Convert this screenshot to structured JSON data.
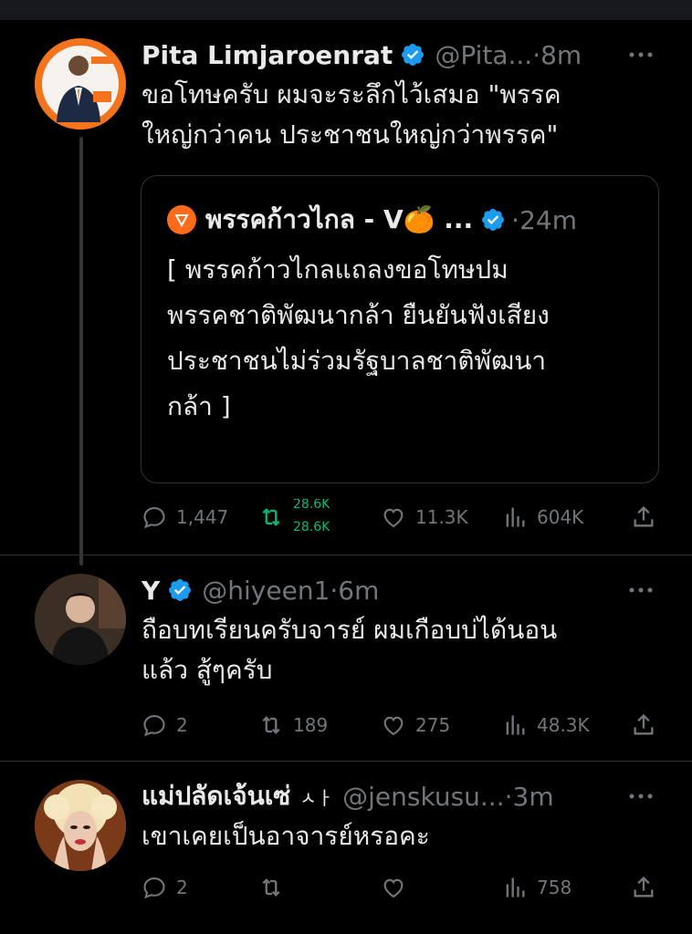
{
  "colors": {
    "background": "#000000",
    "text": "#e7e9ea",
    "muted": "#71767b",
    "verified": "#1d9bf0",
    "retweet_active": "#00ba7c",
    "border": "#2f3336",
    "party_orange": "#ff6b1a"
  },
  "tweets": [
    {
      "name": "Pita Limjaroenrat",
      "handle": "@Pita...",
      "dot": "·",
      "time": "8m",
      "text_line1": "ขอโทษครับ ผมจะระลึกไว้เสมอ \"พรรค",
      "text_line2": "ใหญ่กว่าคน ประชาชนใหญ่กว่าพรรค\"",
      "quote": {
        "name": "พรรคก้าวไกล - V🍊 ...",
        "dot": "·",
        "time": "24m",
        "line1": "[ พรรคก้าวไกลแถลงขอโทษปม",
        "line2": "พรรคชาติพัฒนากล้า ยืนยันฟังเสียง",
        "line3": "ประชาชนไม่ร่วมรัฐบาลชาติพัฒนา",
        "line4": "กล้า ]"
      },
      "replies": "1,447",
      "retweets_top": "28.6K",
      "retweets_bottom": "28.6K",
      "likes": "11.3K",
      "views": "604K"
    },
    {
      "name": "Y",
      "handle": "@hiyeen1",
      "dot": "·",
      "time": "6m",
      "text_line1": "ถือบทเรียนครับจารย์ ผมเกือบบ่ได้นอน",
      "text_line2": "แล้ว สู้ๆครับ",
      "replies": "2",
      "retweets": "189",
      "likes": "275",
      "views": "48.3K"
    },
    {
      "name": "แม่ปลัดเจ้นเซ่",
      "name_suffix": "ㅅㅏ",
      "handle": "@jenskusu...",
      "dot": "·",
      "time": "3m",
      "text_line1": "เขาเคยเป็นอาจารย์หรอคะ",
      "replies": "2",
      "retweets": "",
      "likes": "",
      "views": "758"
    }
  ]
}
